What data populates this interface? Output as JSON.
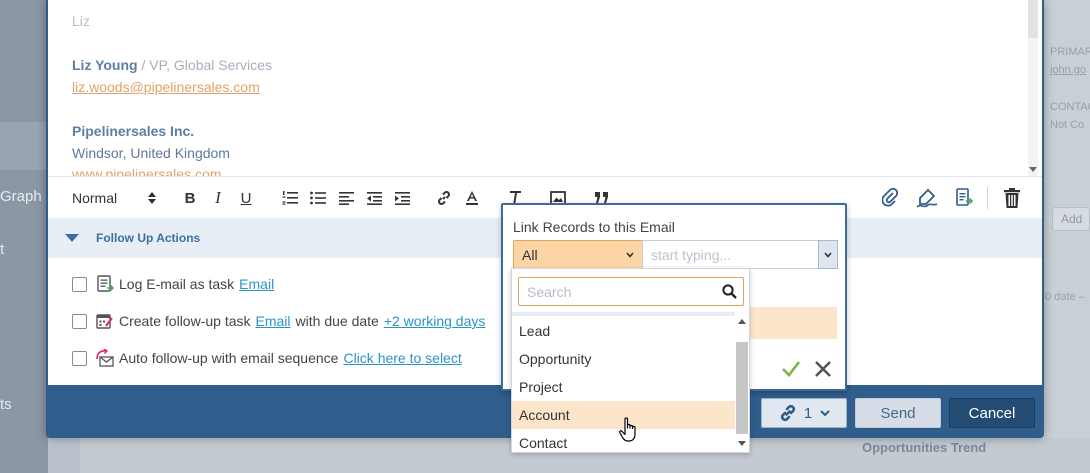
{
  "background": {
    "left_items": [
      "Graph",
      "t",
      "ts"
    ],
    "right_texts": [
      "PRIMARY",
      "john.go",
      "CONTAC",
      "Not Co",
      "0 date –"
    ],
    "add_label": "Add",
    "bottom_text": "Opportunities Trend"
  },
  "editor": {
    "top_line": "Liz",
    "signature_name": "Liz Young",
    "signature_sep": " / ",
    "signature_title": "VP, Global Services",
    "email": "liz.woods@pipelinersales.com",
    "company": "Pipelinersales Inc.",
    "location": "Windsor, United Kingdom",
    "website": "www.pipelinersales.com"
  },
  "toolbar": {
    "style_select": "Normal",
    "bold": "B",
    "italic": "I",
    "underline": "U"
  },
  "follow_up": {
    "title": "Follow Up Actions",
    "rows": [
      {
        "text": "Log E-mail as task",
        "link": "Email"
      },
      {
        "text": "Create follow-up task",
        "link": "Email",
        "text2": "with due date",
        "link2": "+2 working days"
      },
      {
        "text": "Auto follow-up with email sequence",
        "link": "Click here to select"
      }
    ]
  },
  "footer": {
    "link_count": "1",
    "send_label": "Send",
    "cancel_label": "Cancel"
  },
  "link_popup": {
    "title": "Link Records to this Email",
    "type_value": "All",
    "input_placeholder": "start typing..."
  },
  "dropdown": {
    "search_placeholder": "Search",
    "items": [
      "Lead",
      "Opportunity",
      "Project",
      "Account",
      "Contact"
    ],
    "active_item": "Account"
  },
  "colors": {
    "modal_blue": "#2f5d8c",
    "accent_orange": "#e0a35c",
    "highlight_peach": "#fde5cc",
    "link_blue": "#2a95c9",
    "confirm_green": "#7cb342"
  }
}
